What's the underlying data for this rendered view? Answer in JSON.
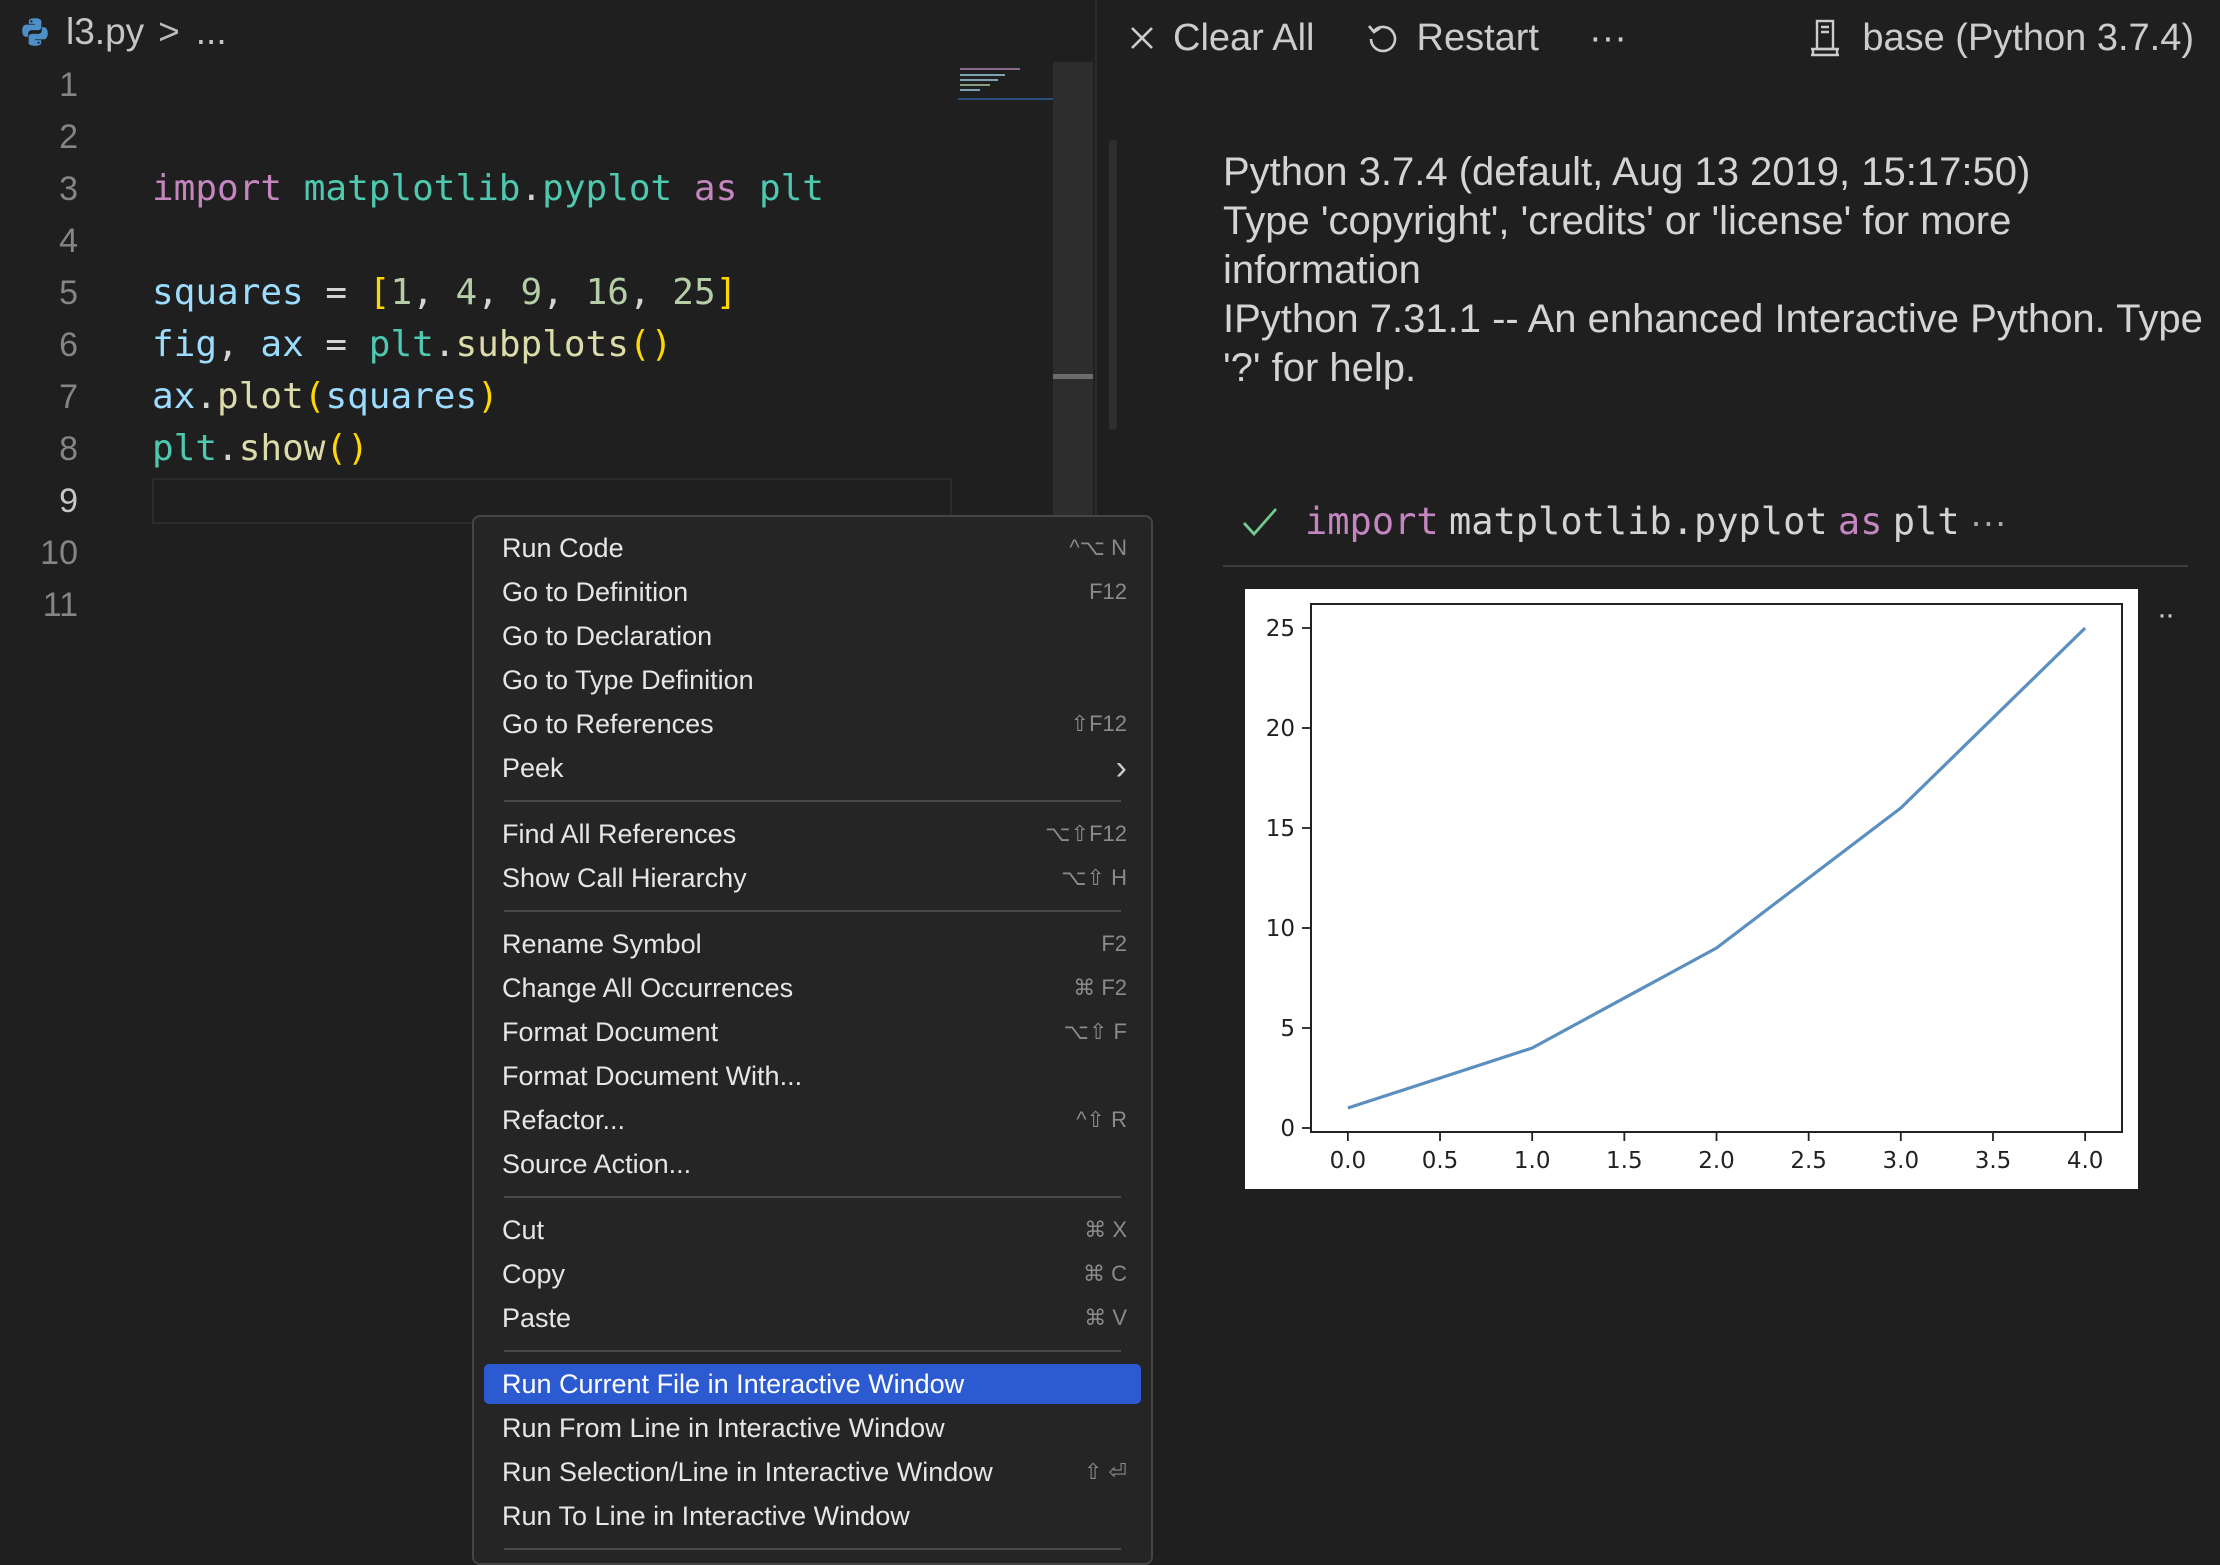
{
  "editor": {
    "breadcrumb": {
      "file": "l3.py",
      "separator": ">",
      "more": "..."
    },
    "line_numbers": [
      "1",
      "2",
      "3",
      "4",
      "5",
      "6",
      "7",
      "8",
      "9",
      "10",
      "11"
    ],
    "code": {
      "l3": [
        "import",
        " ",
        "matplotlib",
        ".",
        "pyplot",
        " ",
        "as",
        " ",
        "plt"
      ],
      "l5": [
        "squares",
        " = ",
        "[",
        "1",
        ", ",
        "4",
        ", ",
        "9",
        ", ",
        "16",
        ", ",
        "25",
        "]"
      ],
      "l6": [
        "fig",
        ", ",
        "ax",
        " = ",
        "plt",
        ".",
        "subplots",
        "(",
        ")"
      ],
      "l7": [
        "ax",
        ".",
        "plot",
        "(",
        "squares",
        ")"
      ],
      "l8": [
        "plt",
        ".",
        "show",
        "(",
        ")"
      ]
    }
  },
  "iw": {
    "toolbar": {
      "clear_all": "Clear All",
      "restart": "Restart",
      "more": "···",
      "kernel": "base (Python 3.7.4)"
    },
    "banner": [
      "Python 3.7.4 (default, Aug 13 2019, 15:17:50)",
      "Type 'copyright', 'credits' or 'license' for more information",
      "IPython 7.31.1 -- An enhanced Interactive Python. Type '?' for help."
    ],
    "cell": {
      "kw_import": "import",
      "module": "matplotlib.pyplot",
      "kw_as": "as",
      "alias": "plt",
      "ellipsis": "···"
    },
    "side_dots": "··"
  },
  "chart_data": {
    "type": "line",
    "x": [
      0,
      1,
      2,
      3,
      4
    ],
    "series": [
      {
        "values": [
          1,
          4,
          9,
          16,
          25
        ]
      }
    ],
    "xlim": [
      -0.2,
      4.2
    ],
    "ylim": [
      -0.2,
      26.2
    ],
    "xticks": [
      "0.0",
      "0.5",
      "1.0",
      "1.5",
      "2.0",
      "2.5",
      "3.0",
      "3.5",
      "4.0"
    ],
    "yticks": [
      "0",
      "5",
      "10",
      "15",
      "20",
      "25"
    ],
    "grid": false,
    "line_color": "#5b8fbf"
  },
  "context_menu": {
    "items": [
      {
        "label": "Run Code",
        "key": "^⌥ N"
      },
      {
        "label": "Go to Definition",
        "key": "F12"
      },
      {
        "label": "Go to Declaration",
        "key": ""
      },
      {
        "label": "Go to Type Definition",
        "key": ""
      },
      {
        "label": "Go to References",
        "key": "⇧F12"
      },
      {
        "label": "Peek",
        "key": "›"
      },
      {
        "label": "Find All References",
        "key": "⌥⇧F12"
      },
      {
        "label": "Show Call Hierarchy",
        "key": "⌥⇧ H"
      },
      {
        "label": "Rename Symbol",
        "key": "F2"
      },
      {
        "label": "Change All Occurrences",
        "key": "⌘ F2"
      },
      {
        "label": "Format Document",
        "key": "⌥⇧ F"
      },
      {
        "label": "Format Document With...",
        "key": ""
      },
      {
        "label": "Refactor...",
        "key": "^⇧ R"
      },
      {
        "label": "Source Action...",
        "key": ""
      },
      {
        "label": "Cut",
        "key": "⌘ X"
      },
      {
        "label": "Copy",
        "key": "⌘ C"
      },
      {
        "label": "Paste",
        "key": "⌘ V"
      },
      {
        "label": "Run Current File in Interactive Window",
        "key": ""
      },
      {
        "label": "Run From Line in Interactive Window",
        "key": ""
      },
      {
        "label": "Run Selection/Line in Interactive Window",
        "key": "⇧ ⏎"
      },
      {
        "label": "Run To Line in Interactive Window",
        "key": ""
      }
    ]
  },
  "colors": {
    "selection": "#2c5ad0",
    "keyword": "#c586c0",
    "module": "#4ec9b0",
    "variable": "#9cdcfe",
    "number": "#b5cea8",
    "function": "#dcdcaa"
  }
}
